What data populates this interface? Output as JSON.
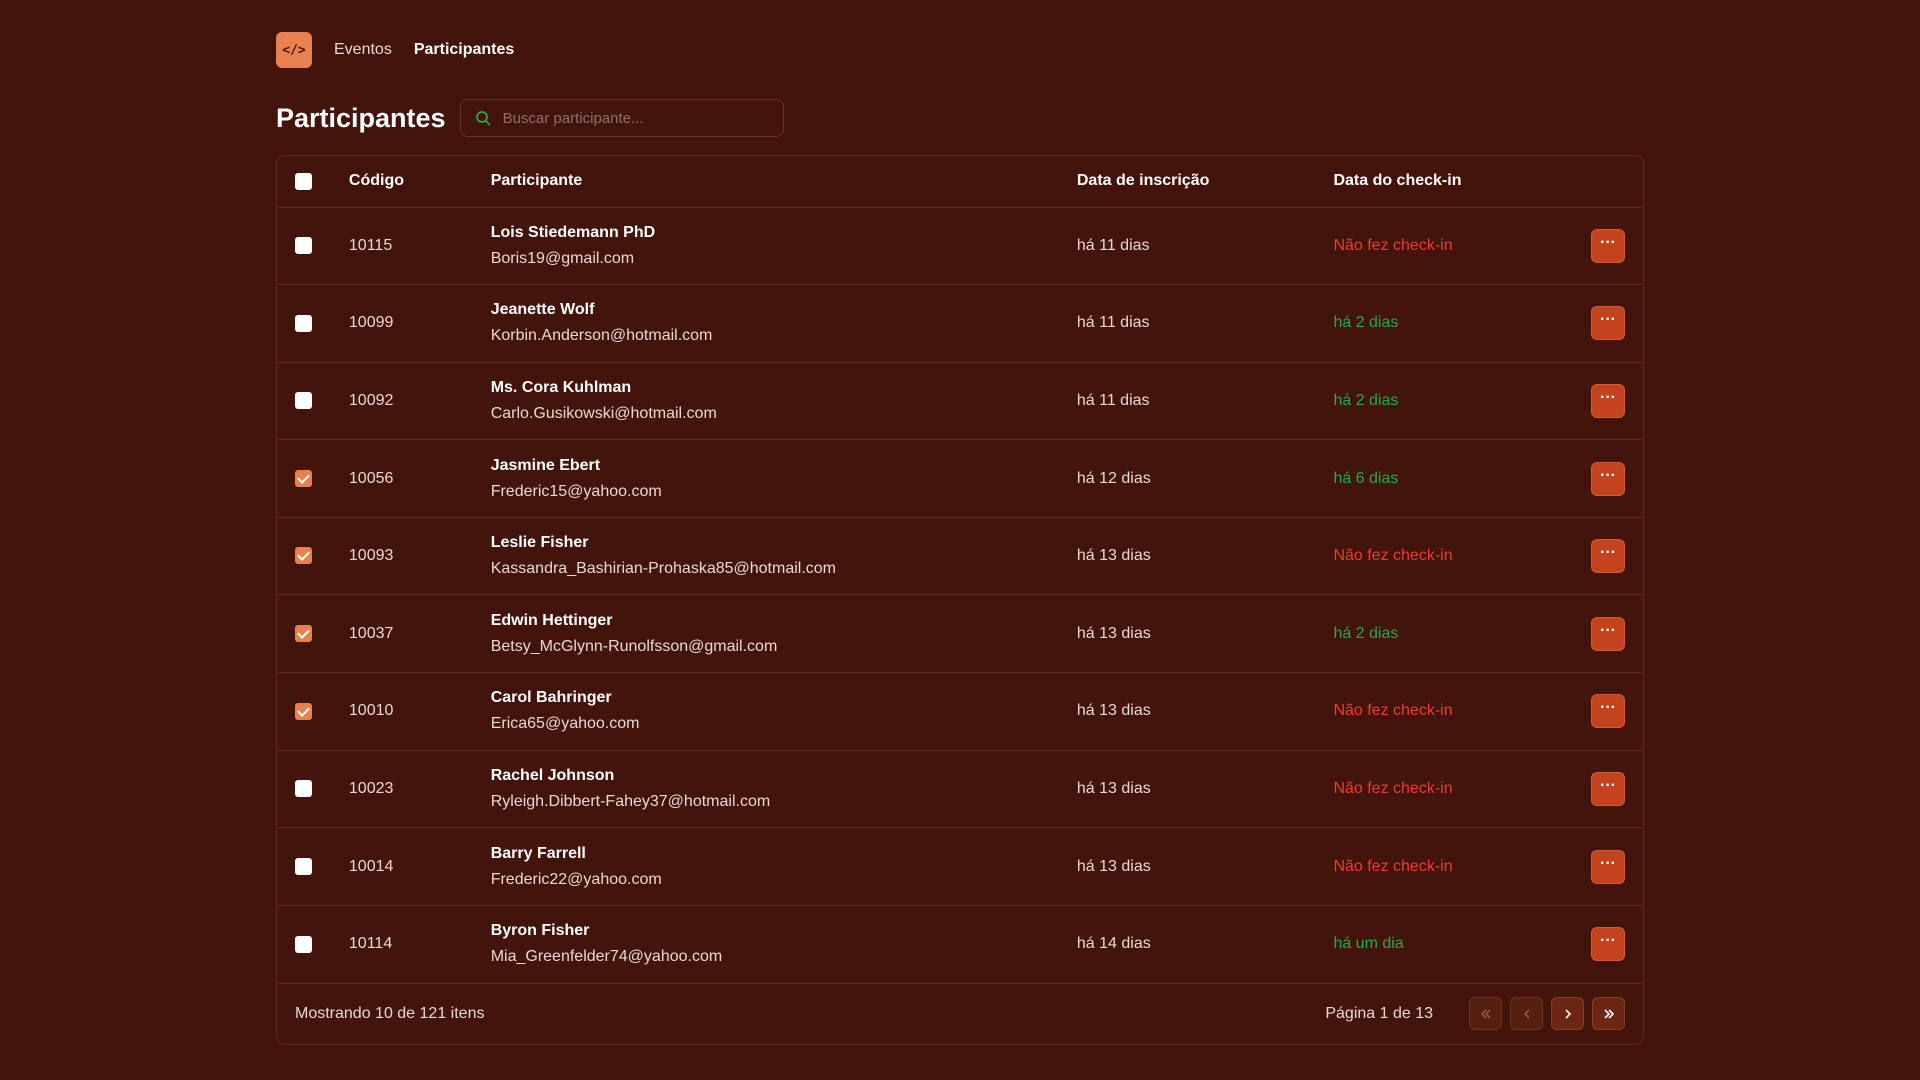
{
  "nav": {
    "logo_text": "</>",
    "links": [
      "Eventos",
      "Participantes"
    ],
    "active": "Participantes"
  },
  "page": {
    "title": "Participantes",
    "search_placeholder": "Buscar participante..."
  },
  "table": {
    "headers": {
      "code": "Código",
      "participant": "Participante",
      "subscribed": "Data de inscrição",
      "checkin": "Data do check-in"
    },
    "rows": [
      {
        "checked": false,
        "code": "10115",
        "name": "Lois Stiedemann PhD",
        "email": "Boris19@gmail.com",
        "subscribed": "há 11 dias",
        "checkin": "Não fez check-in",
        "checked_in": false
      },
      {
        "checked": false,
        "code": "10099",
        "name": "Jeanette Wolf",
        "email": "Korbin.Anderson@hotmail.com",
        "subscribed": "há 11 dias",
        "checkin": "há 2 dias",
        "checked_in": true
      },
      {
        "checked": false,
        "code": "10092",
        "name": "Ms. Cora Kuhlman",
        "email": "Carlo.Gusikowski@hotmail.com",
        "subscribed": "há 11 dias",
        "checkin": "há 2 dias",
        "checked_in": true
      },
      {
        "checked": true,
        "code": "10056",
        "name": "Jasmine Ebert",
        "email": "Frederic15@yahoo.com",
        "subscribed": "há 12 dias",
        "checkin": "há 6 dias",
        "checked_in": true
      },
      {
        "checked": true,
        "code": "10093",
        "name": "Leslie Fisher",
        "email": "Kassandra_Bashirian-Prohaska85@hotmail.com",
        "subscribed": "há 13 dias",
        "checkin": "Não fez check-in",
        "checked_in": false
      },
      {
        "checked": true,
        "code": "10037",
        "name": "Edwin Hettinger",
        "email": "Betsy_McGlynn-Runolfsson@gmail.com",
        "subscribed": "há 13 dias",
        "checkin": "há 2 dias",
        "checked_in": true
      },
      {
        "checked": true,
        "code": "10010",
        "name": "Carol Bahringer",
        "email": "Erica65@yahoo.com",
        "subscribed": "há 13 dias",
        "checkin": "Não fez check-in",
        "checked_in": false
      },
      {
        "checked": false,
        "code": "10023",
        "name": "Rachel Johnson",
        "email": "Ryleigh.Dibbert-Fahey37@hotmail.com",
        "subscribed": "há 13 dias",
        "checkin": "Não fez check-in",
        "checked_in": false
      },
      {
        "checked": false,
        "code": "10014",
        "name": "Barry Farrell",
        "email": "Frederic22@yahoo.com",
        "subscribed": "há 13 dias",
        "checkin": "Não fez check-in",
        "checked_in": false
      },
      {
        "checked": false,
        "code": "10114",
        "name": "Byron Fisher",
        "email": "Mia_Greenfelder74@yahoo.com",
        "subscribed": "há 14 dias",
        "checkin": "há um dia",
        "checked_in": true
      }
    ],
    "row_action_icon": "more-horizontal-icon"
  },
  "footer": {
    "showing": "Mostrando 10 de 121 itens",
    "page_info": "Página 1 de 13"
  },
  "colors": {
    "background": "#43140b",
    "accent": "#e8814d",
    "action_button": "#c2431d",
    "status_not_checked": "#ee3b2e",
    "status_checked": "#23a84a"
  }
}
